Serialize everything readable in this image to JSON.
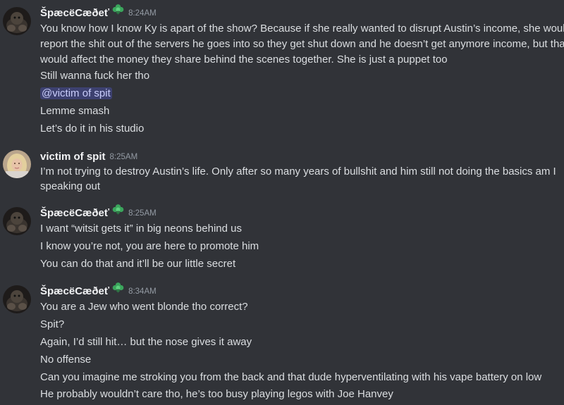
{
  "colors": {
    "background": "#313338",
    "username": "#f2f3f5",
    "message_text": "#dbdee1",
    "timestamp": "#949ba4",
    "mention_bg": "#4a4f82",
    "mention_text": "#c9cdfb",
    "badge_green": "#3ba55c"
  },
  "messages": [
    {
      "author": "ŠpæcëCæðeť",
      "badge_icon": "green-flower-icon",
      "time": "8:24AM",
      "lines": [
        "You know how I know Ky is apart of the show? Because if she really wanted to disrupt Austin’s income, she would",
        "report the shit out of the servers he goes into so they get shut down and he doesn’t get anymore income, but that",
        "would affect the money they share behind the scenes together. She is just a puppet too",
        "Still wanna fuck her tho",
        "@victim of spit",
        "Lemme smash",
        "Let’s do it in his studio"
      ]
    },
    {
      "author": "victim of spit",
      "time": "8:25AM",
      "lines": [
        "I’m not trying to destroy Austin’s life. Only after so many years of bullshit and him still not doing the basics am I",
        "speaking out"
      ]
    },
    {
      "author": "ŠpæcëCæðeť",
      "badge_icon": "green-flower-icon",
      "time": "8:25AM",
      "lines": [
        "I want “witsit gets it” in big neons behind us",
        "I know you’re not, you are here to promote him",
        "You can do that and it’ll be our little secret"
      ]
    },
    {
      "author": "ŠpæcëCæðeť",
      "badge_icon": "green-flower-icon",
      "time": "8:34AM",
      "lines": [
        "You are a Jew who went blonde tho correct?",
        "Spit?",
        "Again, I’d still hit… but the nose gives it away",
        "No offense",
        "Can you imagine me stroking you from the back and that dude hyperventilating with his vape battery on low",
        "He probably wouldn’t care tho, he’s too busy playing legos with Joe Hanvey"
      ]
    }
  ]
}
